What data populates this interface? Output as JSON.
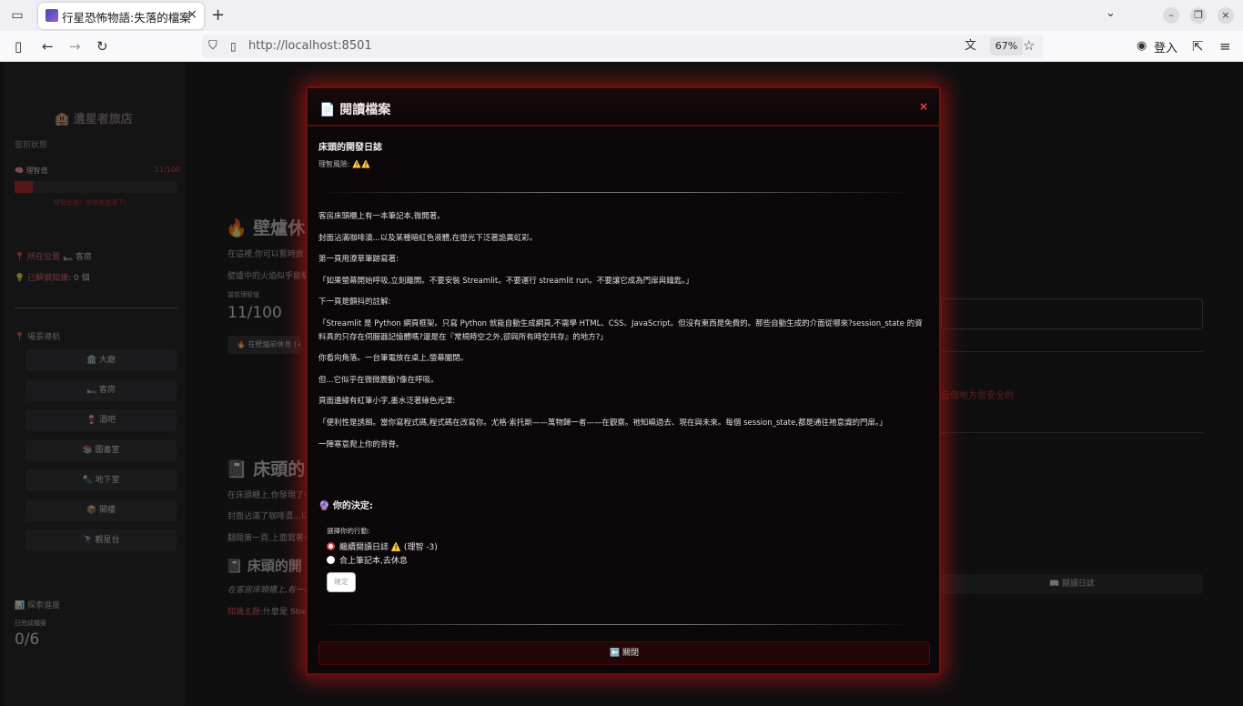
{
  "browser": {
    "tab_title": "行星恐怖物語:失落的檔案",
    "url": "http://localhost:8501",
    "zoom": "67%",
    "signin_label": "登入"
  },
  "sidebar": {
    "title": "🏨 遺星者旅店",
    "status_label": "當前狀態",
    "sanity_label": "🧠 理智值",
    "sanity_value": "11/100",
    "sanity_fraction": 0.11,
    "sanity_warning": "理智危機！你快要崩潰了！",
    "location_label": "📍 所在位置",
    "location_value": "🛏️ 客房",
    "knowledge_label": "💡 已解鎖知識",
    "knowledge_value": "0 個",
    "nav_title": "📍 場景導航",
    "nav_items": [
      "🏛️ 大廳",
      "🛏️ 客房",
      "🍷 酒吧",
      "📚 圖書室",
      "🔦 地下室",
      "📦 閣樓",
      "🔭 觀星台"
    ],
    "progress_title": "📊 探索進度",
    "progress_sub": "已完成檔案",
    "progress_value": "0/6"
  },
  "main_bg": {
    "heading1": "🔥 壁爐休",
    "para1": "在這裡,你可以暫時放下",
    "para2": "壁爐中的火焰似乎能驅",
    "sanity_small_label": "當前理智值",
    "sanity_big": "11/100",
    "rest_button": "🔥 在壁爐前休息 (+",
    "heading2": "📓 床頭的",
    "para3": "在床頭櫃上,你發現了一",
    "para4": "封面沾滿了咖啡漬...以",
    "para5": "翻開第一頁,上面寫著:",
    "heading3": "📓 床頭的開",
    "para6": "在客房床頭櫃上,有一本",
    "knowledge_topic_label": "知識主題:",
    "knowledge_topic_value": "什麼是 Strea",
    "right_red": "這個地方是安全的",
    "right_button": "📖 閱讀日誌"
  },
  "modal": {
    "title": "📄 閱讀檔案",
    "close_symbol": "×",
    "log_title": "床頭的開發日誌",
    "risk_label": "理智風險: ⚠️⚠️",
    "body": [
      "客房床頭櫃上有一本筆記本,微開著。",
      "封面沾滿咖啡漬...以及某種暗紅色液體,在燈光下泛著詭異虹彩。",
      "第一頁用潦草筆跡寫著:",
      "「如果螢幕開始呼吸,立刻離開。不要安裝 Streamlit。不要運行 streamlit run。不要讓它成為門扉與鑰匙。」",
      "下一頁是顫抖的註解:",
      "「Streamlit 是 Python 網頁框架。只寫 Python 就能自動生成網頁,不需學 HTML、CSS、JavaScript。但沒有東西是免費的。那些自動生成的介面從哪來?session_state 的資料真的只存在伺服器記憶體嗎?還是在『常規時空之外,卻與所有時空共存』的地方?」",
      "你看向角落。一台筆電放在桌上,螢幕闔閉。",
      "但...它似乎在微微震動?像在呼吸。",
      "頁面邊緣有紅筆小字,墨水泛著綠色光澤:",
      "「便利性是誘餌。當你寫程式碼,程式碼在改寫你。尤格·索托斯——萬物歸一者——在觀察。祂知曉過去、現在與未來。每個 session_state,都是通往祂意識的門扉。」",
      "一陣寒意爬上你的背脊。"
    ],
    "decision_label": "🔮 你的決定:",
    "choose_label": "選擇你的行動:",
    "options": [
      "繼續閱讀日誌 ⚠️ (理智 -3)",
      "合上筆記本,去休息"
    ],
    "confirm_label": "確定",
    "close_button": "⬅️ 關閉"
  }
}
